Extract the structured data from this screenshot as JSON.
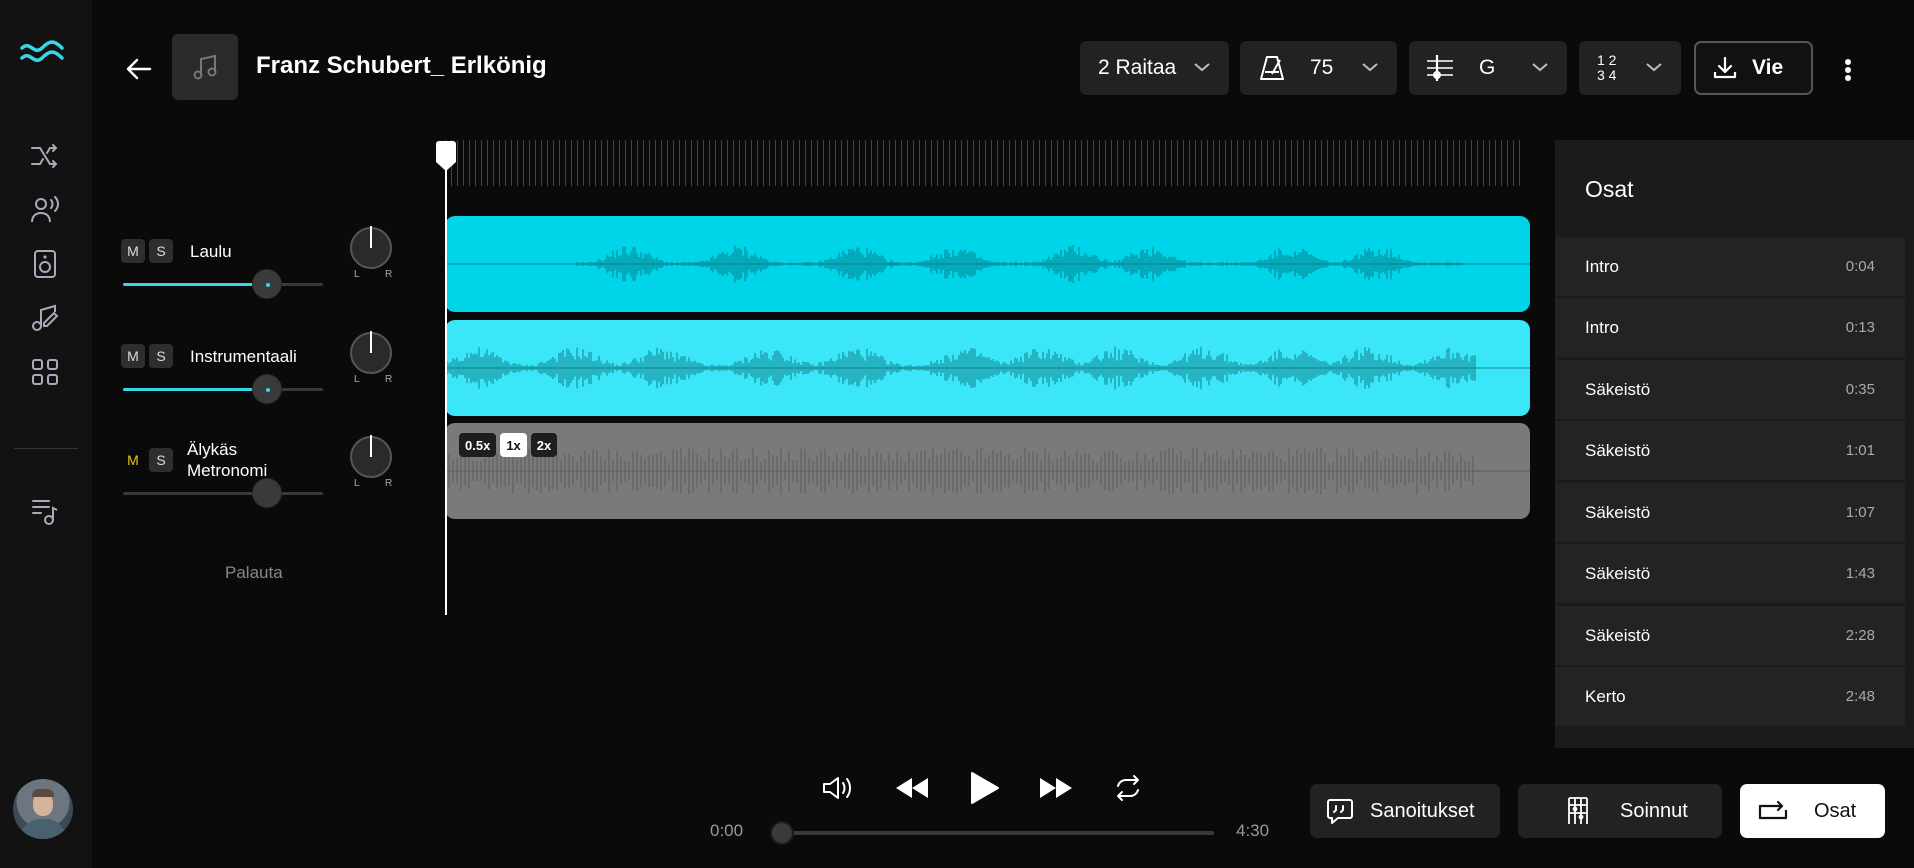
{
  "header": {
    "song_title": "Franz Schubert_ Erlkönig",
    "tracks_button": "2 Raitaa",
    "tempo_value": "75",
    "key_value": "G",
    "time_sig_top": "1 2",
    "time_sig_bottom": "3 4",
    "export_label": "Vie"
  },
  "tracks": [
    {
      "name": "Laulu",
      "mute": "M",
      "solo": "S",
      "volume": 0.72,
      "knob_left": "L",
      "knob_right": "R"
    },
    {
      "name": "Instrumentaali",
      "mute": "M",
      "solo": "S",
      "volume": 0.72,
      "knob_left": "L",
      "knob_right": "R"
    },
    {
      "name_line1": "Älykäs",
      "name_line2": "Metronomi",
      "mute": "M",
      "solo": "S",
      "volume": 0.72,
      "mute_active": true,
      "knob_left": "L",
      "knob_right": "R"
    }
  ],
  "reset_label": "Palauta",
  "metronome_speeds": [
    "0.5x",
    "1x",
    "2x"
  ],
  "metronome_active_speed": "1x",
  "sections_panel": {
    "title": "Osat",
    "items": [
      {
        "name": "Intro",
        "time": "0:04"
      },
      {
        "name": "Intro",
        "time": "0:13"
      },
      {
        "name": "Säkeistö",
        "time": "0:35"
      },
      {
        "name": "Säkeistö",
        "time": "1:01"
      },
      {
        "name": "Säkeistö",
        "time": "1:07"
      },
      {
        "name": "Säkeistö",
        "time": "1:43"
      },
      {
        "name": "Säkeistö",
        "time": "2:28"
      },
      {
        "name": "Kerto",
        "time": "2:48"
      }
    ]
  },
  "transport": {
    "current_time": "0:00",
    "total_time": "4:30",
    "progress": 0
  },
  "bottom_buttons": {
    "lyrics": "Sanoitukset",
    "chords": "Soinnut",
    "sections": "Osat"
  },
  "colors": {
    "accent": "#35d6e6",
    "vocal_lane": "#00d4e8",
    "instrumental_lane": "#3ae6f7",
    "metronome_lane": "#7a7a7a",
    "mute_active": "#f0c419"
  }
}
